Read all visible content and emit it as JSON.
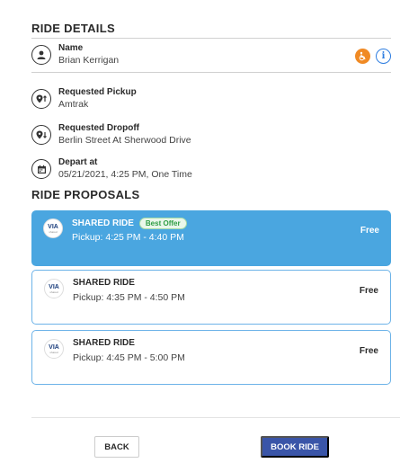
{
  "ride_details": {
    "title": "RIDE DETAILS",
    "name_label": "Name",
    "name_value": "Brian Kerrigan",
    "pickup_label": "Requested Pickup",
    "pickup_value": "Amtrak",
    "dropoff_label": "Requested Dropoff",
    "dropoff_value": "Berlin Street At Sherwood Drive",
    "depart_label": "Depart at",
    "depart_value": "05/21/2021, 4:25 PM, One Time"
  },
  "ride_proposals": {
    "title": "RIDE PROPOSALS",
    "items": [
      {
        "name": "SHARED RIDE",
        "badge": "Best Offer",
        "time": "Pickup: 4:25 PM - 4:40 PM",
        "price": "Free",
        "selected": true
      },
      {
        "name": "SHARED RIDE",
        "time": "Pickup: 4:35 PM - 4:50 PM",
        "price": "Free",
        "selected": false
      },
      {
        "name": "SHARED RIDE",
        "time": "Pickup: 4:45 PM - 5:00 PM",
        "price": "Free",
        "selected": false
      }
    ],
    "logo_text": "VIA",
    "logo_sub": "shared"
  },
  "footer": {
    "back_label": "BACK",
    "book_label": "BOOK RIDE"
  },
  "colors": {
    "selected_bg": "#4aa6e0",
    "book_button": "#3a55a8",
    "badge_green": "#2f9e44",
    "info_blue": "#2e7de0",
    "accessibility_orange": "#f08a24"
  }
}
